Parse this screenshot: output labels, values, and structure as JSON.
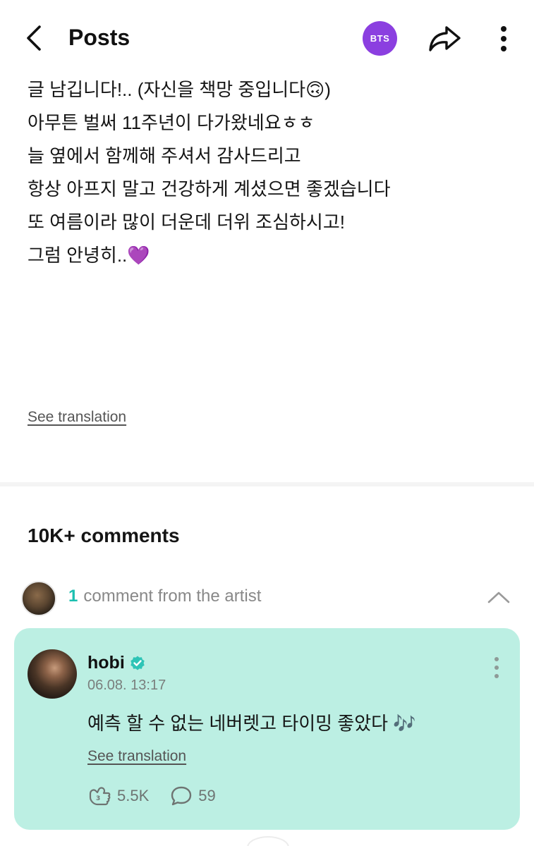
{
  "header": {
    "title": "Posts",
    "community_badge": "BTS",
    "back_icon": "chevron-left-icon",
    "share_icon": "share-arrow-icon",
    "more_icon": "vertical-dots-icon"
  },
  "post": {
    "lines": [
      "글 남깁니다!.. (자신을 책망 중입니다🙃)",
      "아무튼 벌써 11주년이 다가왔네요ㅎㅎ",
      "늘 옆에서 함께해 주셔서 감사드리고",
      "항상 아프지 말고 건강하게 계셨으면 좋겠습니다",
      "또 여름이라 많이 더운데 더위 조심하시고!",
      "그럼 안녕히..💜"
    ],
    "see_translation": "See translation"
  },
  "comments": {
    "count_label": "10K+ comments",
    "artist_section": {
      "count": "1",
      "label": "comment from the artist"
    },
    "artist_comment": {
      "username": "hobi",
      "timestamp": "06.08. 13:17",
      "text": "예측 할 수 없는 네버렛고 타이밍 좋았다 🎶",
      "see_translation": "See translation",
      "likes": "5.5K",
      "replies": "59"
    }
  },
  "colors": {
    "badge_purple": "#8b3fe0",
    "card_mint": "#bcefe3",
    "artist_count_teal": "#1bbfb0",
    "verified_teal": "#2ec4b6"
  }
}
